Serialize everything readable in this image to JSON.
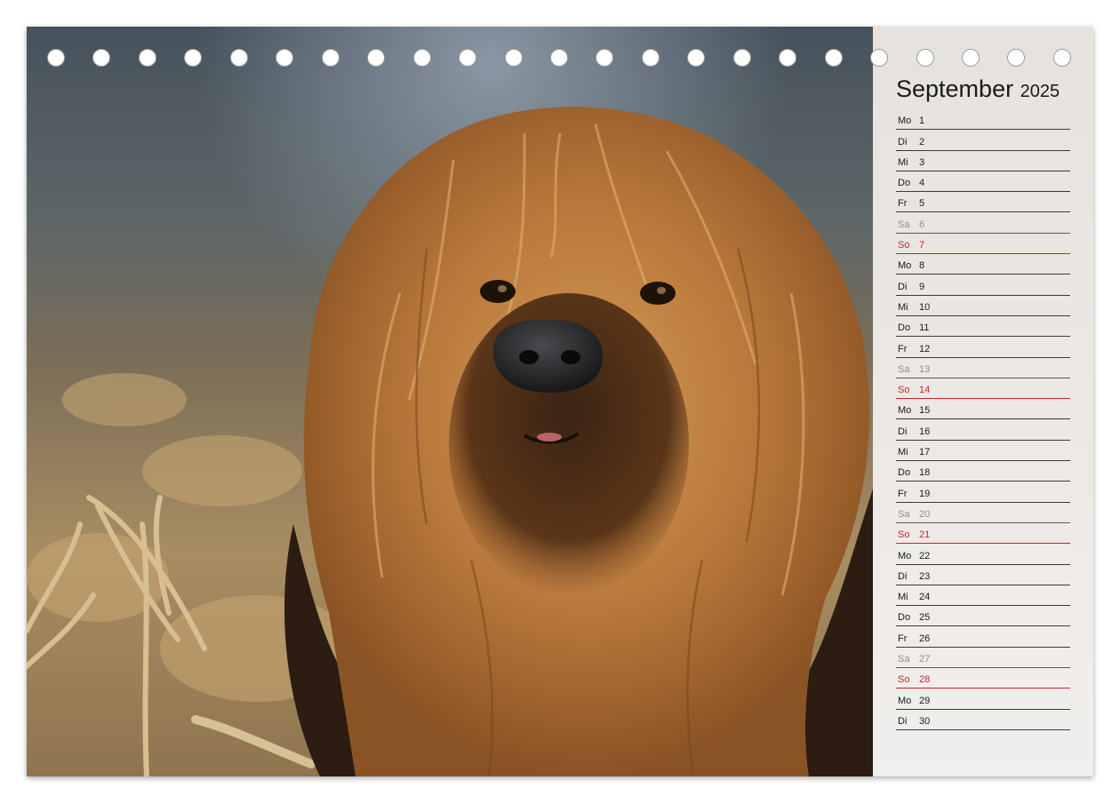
{
  "calendar": {
    "month": "September",
    "year": "2025",
    "days": [
      {
        "wd": "Mo",
        "d": "1",
        "type": "weekday"
      },
      {
        "wd": "Di",
        "d": "2",
        "type": "weekday"
      },
      {
        "wd": "Mi",
        "d": "3",
        "type": "weekday"
      },
      {
        "wd": "Do",
        "d": "4",
        "type": "weekday"
      },
      {
        "wd": "Fr",
        "d": "5",
        "type": "weekday"
      },
      {
        "wd": "Sa",
        "d": "6",
        "type": "saturday"
      },
      {
        "wd": "So",
        "d": "7",
        "type": "sunday"
      },
      {
        "wd": "Mo",
        "d": "8",
        "type": "weekday"
      },
      {
        "wd": "Di",
        "d": "9",
        "type": "weekday"
      },
      {
        "wd": "Mi",
        "d": "10",
        "type": "weekday"
      },
      {
        "wd": "Do",
        "d": "11",
        "type": "weekday"
      },
      {
        "wd": "Fr",
        "d": "12",
        "type": "weekday"
      },
      {
        "wd": "Sa",
        "d": "13",
        "type": "saturday"
      },
      {
        "wd": "So",
        "d": "14",
        "type": "sunday"
      },
      {
        "wd": "Mo",
        "d": "15",
        "type": "weekday"
      },
      {
        "wd": "Di",
        "d": "16",
        "type": "weekday"
      },
      {
        "wd": "Mi",
        "d": "17",
        "type": "weekday"
      },
      {
        "wd": "Do",
        "d": "18",
        "type": "weekday"
      },
      {
        "wd": "Fr",
        "d": "19",
        "type": "weekday"
      },
      {
        "wd": "Sa",
        "d": "20",
        "type": "saturday"
      },
      {
        "wd": "So",
        "d": "21",
        "type": "sunday"
      },
      {
        "wd": "Mo",
        "d": "22",
        "type": "weekday"
      },
      {
        "wd": "Di",
        "d": "23",
        "type": "weekday"
      },
      {
        "wd": "Mi",
        "d": "24",
        "type": "weekday"
      },
      {
        "wd": "Do",
        "d": "25",
        "type": "weekday"
      },
      {
        "wd": "Fr",
        "d": "26",
        "type": "weekday"
      },
      {
        "wd": "Sa",
        "d": "27",
        "type": "saturday"
      },
      {
        "wd": "So",
        "d": "28",
        "type": "sunday"
      },
      {
        "wd": "Mo",
        "d": "29",
        "type": "weekday"
      },
      {
        "wd": "Di",
        "d": "30",
        "type": "weekday"
      }
    ]
  },
  "binding": {
    "hole_count": 23
  },
  "colors": {
    "sunday": "#c8242b",
    "saturday": "#8e8e8e",
    "text": "#1a1a1a"
  },
  "photo": {
    "subject": "long-haired-dog-portrait"
  }
}
